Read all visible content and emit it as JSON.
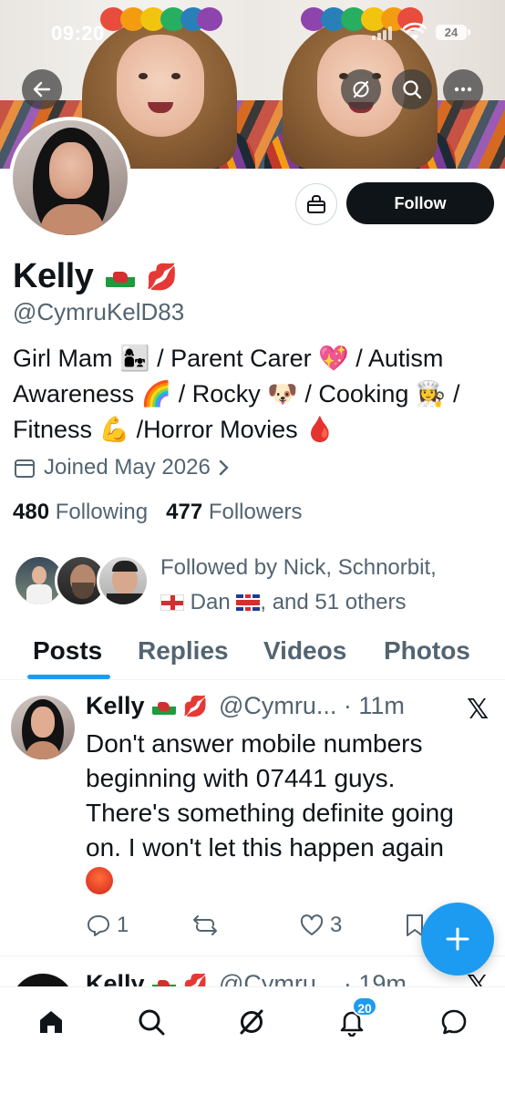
{
  "status_bar": {
    "time": "09:20",
    "battery": "24"
  },
  "profile": {
    "name": "Kelly",
    "handle": "@CymruKelD83",
    "bio_lines": [
      "Girl Mam 👩‍👧 / Parent Carer 💖 / Autism",
      "Awareness 🌈 / Rocky 🐶 / Cooking 👩‍🍳 /",
      "Fitness 💪 /Horror Movies 🩸"
    ],
    "joined": "Joined May 2026",
    "following_count": "480",
    "following_label": "Following",
    "followers_count": "477",
    "followers_label": "Followers",
    "followed_by_line1": "Followed by Nick, Schnorbit,",
    "followed_by_dan": "Dan",
    "followed_by_rest": ", and 51 others"
  },
  "actions": {
    "follow_label": "Follow"
  },
  "tabs": [
    {
      "label": "Posts"
    },
    {
      "label": "Replies"
    },
    {
      "label": "Videos"
    },
    {
      "label": "Photos"
    }
  ],
  "tweet": {
    "name": "Kelly",
    "handle_time": "@Cymru... · 11m",
    "lines": [
      "Don't answer mobile numbers",
      "beginning with 07441 guys.",
      "There's something definite going",
      "on. I won't let this happen again"
    ],
    "reply_count": "1",
    "like_count": "3"
  },
  "tweet2": {
    "name": "Kelly",
    "handle_time": "@Cymru... · 19m"
  },
  "nav": {
    "notification_badge": "20"
  },
  "colors": {
    "accent": "#1d9bf0",
    "text": "#0f1419",
    "muted": "#536471"
  }
}
